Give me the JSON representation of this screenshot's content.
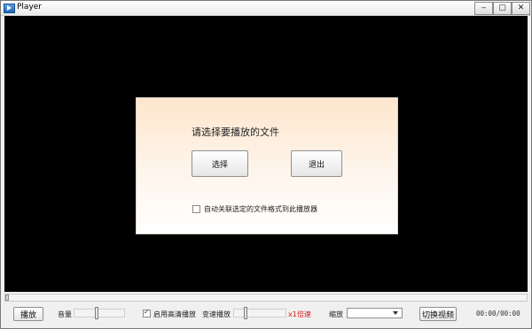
{
  "window": {
    "title": "Player",
    "icon": "player-app-icon",
    "controls": {
      "minimize": "‒",
      "maximize": "▢",
      "close": "✕"
    }
  },
  "dialog": {
    "prompt": "请选择要播放的文件",
    "select_button": "选择",
    "exit_button": "退出",
    "associate_checkbox": {
      "label": "自动关联选定的文件格式到此播放器",
      "checked": false
    }
  },
  "seek": {
    "progress": 0
  },
  "controls": {
    "play_button": "播放",
    "volume_label": "音量",
    "volume_level": 0.45,
    "hd_checkbox": {
      "label": "启用高清播放",
      "checked": true
    },
    "speed_label": "变速播放",
    "speed_level": 0.2,
    "speed_value": "x1倍速",
    "scale_label": "缩放",
    "scale_value": "",
    "switch_video_button": "切换视频",
    "time": "00:00/00:00"
  },
  "colors": {
    "video_bg": "#000000",
    "dialog_top": "#fde6cc",
    "dialog_bottom": "#ffffff",
    "speed_value_text": "#d61c1c"
  }
}
